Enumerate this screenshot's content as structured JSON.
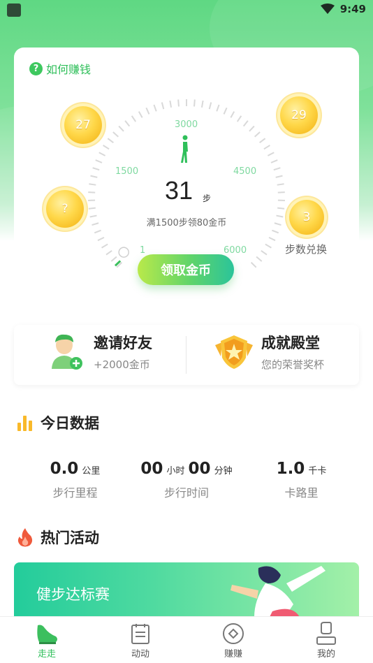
{
  "status_bar": {
    "time": "9:49"
  },
  "main_card": {
    "how_earn": "如何赚钱",
    "scale_labels": [
      "1",
      "1500",
      "3000",
      "4500",
      "6000"
    ],
    "steps": "31",
    "steps_unit": "步",
    "goal_text": "满1500步领80金币",
    "coins": [
      "27",
      "29",
      "?",
      "3"
    ],
    "exchange_label": "步数兑换",
    "collect_button": "领取金币",
    "progress_fraction": 0.005
  },
  "features": {
    "invite": {
      "title": "邀请好友",
      "sub": "+2000金币"
    },
    "achievement": {
      "title": "成就殿堂",
      "sub": "您的荣誉奖杯"
    }
  },
  "today": {
    "title": "今日数据",
    "distance": {
      "value": "0.0",
      "unit": "公里",
      "label": "步行里程"
    },
    "time": {
      "hours": "00",
      "hours_unit": "小时",
      "minutes": "00",
      "minutes_unit": "分钟",
      "label": "步行时间"
    },
    "calories": {
      "value": "1.0",
      "unit": "千卡",
      "label": "卡路里"
    }
  },
  "hot": {
    "title": "热门活动",
    "banner_title": "健步达标赛"
  },
  "nav": {
    "items": [
      {
        "label": "走走",
        "icon": "shoe-icon",
        "active": true
      },
      {
        "label": "动动",
        "icon": "notepad-icon"
      },
      {
        "label": "赚赚",
        "icon": "coin-diamond-icon"
      },
      {
        "label": "我的",
        "icon": "person-icon"
      }
    ]
  },
  "colors": {
    "accent": "#2fbf5a",
    "coin": "#f8c22a"
  }
}
